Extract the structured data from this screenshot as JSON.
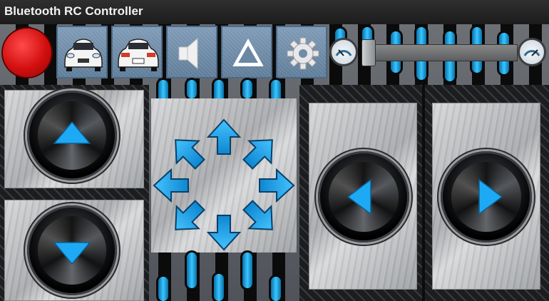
{
  "app": {
    "title": "Bluetooth RC Controller"
  },
  "colors": {
    "accent": "#1ea9f5",
    "record": "#e01515",
    "toolbar_button": "#6f8ca8",
    "title_bar": "#222222"
  },
  "toolbar": {
    "buttons": [
      {
        "name": "record",
        "icon": "red-circle-icon"
      },
      {
        "name": "front-lights",
        "icon": "car-front-icon"
      },
      {
        "name": "back-lights",
        "icon": "car-rear-icon"
      },
      {
        "name": "horn",
        "icon": "speaker-icon"
      },
      {
        "name": "extra",
        "icon": "triangle-warning-icon"
      },
      {
        "name": "settings",
        "icon": "gear-icon"
      }
    ]
  },
  "speed": {
    "level": 0,
    "min_icon": "speedometer-low-icon",
    "max_icon": "speedometer-high-icon"
  },
  "controls": {
    "forward_icon": "arrow-up-icon",
    "backward_icon": "arrow-down-icon",
    "left_icon": "arrow-left-icon",
    "right_icon": "arrow-right-icon",
    "direction_pad": [
      "up",
      "up-right",
      "right",
      "down-right",
      "down",
      "down-left",
      "left",
      "up-left"
    ]
  }
}
